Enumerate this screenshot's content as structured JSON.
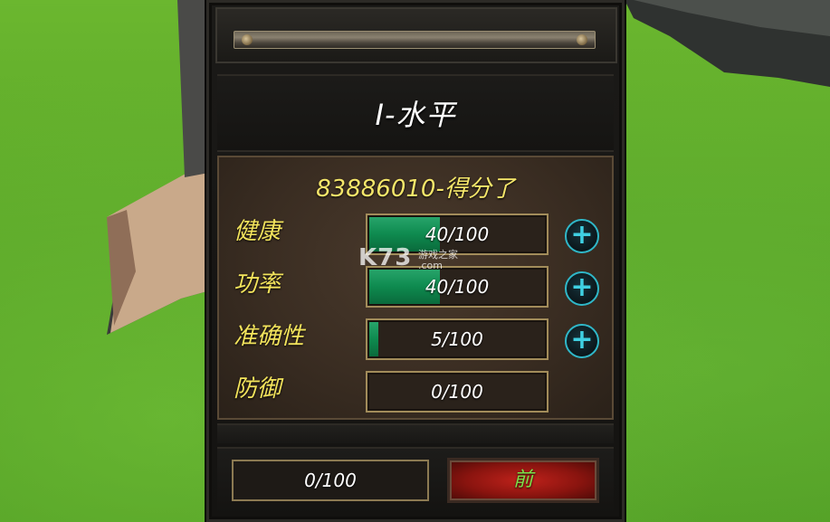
{
  "level_title": "I-水平",
  "points_label": "83886010-得分了",
  "stats": [
    {
      "name": "健康",
      "value_text": "40/100",
      "fill": 0.4,
      "has_plus": true
    },
    {
      "name": "功率",
      "value_text": "40/100",
      "fill": 0.4,
      "has_plus": true
    },
    {
      "name": "准确性",
      "value_text": "5/100",
      "fill": 0.05,
      "has_plus": true
    },
    {
      "name": "防御",
      "value_text": "0/100",
      "fill": 0.0,
      "has_plus": false
    }
  ],
  "total_text": "0/100",
  "next_button": "前",
  "plus_icon": "plus-icon",
  "watermark": {
    "logo": "K73",
    "cn": "游戏之家",
    "com": ".com"
  },
  "colors": {
    "label_yellow": "#f2e35c",
    "bar_green": "#0e8a4f",
    "plus_cyan": "#2fb7c8",
    "button_red": "#c0221b",
    "button_text_green": "#7ee34a"
  }
}
